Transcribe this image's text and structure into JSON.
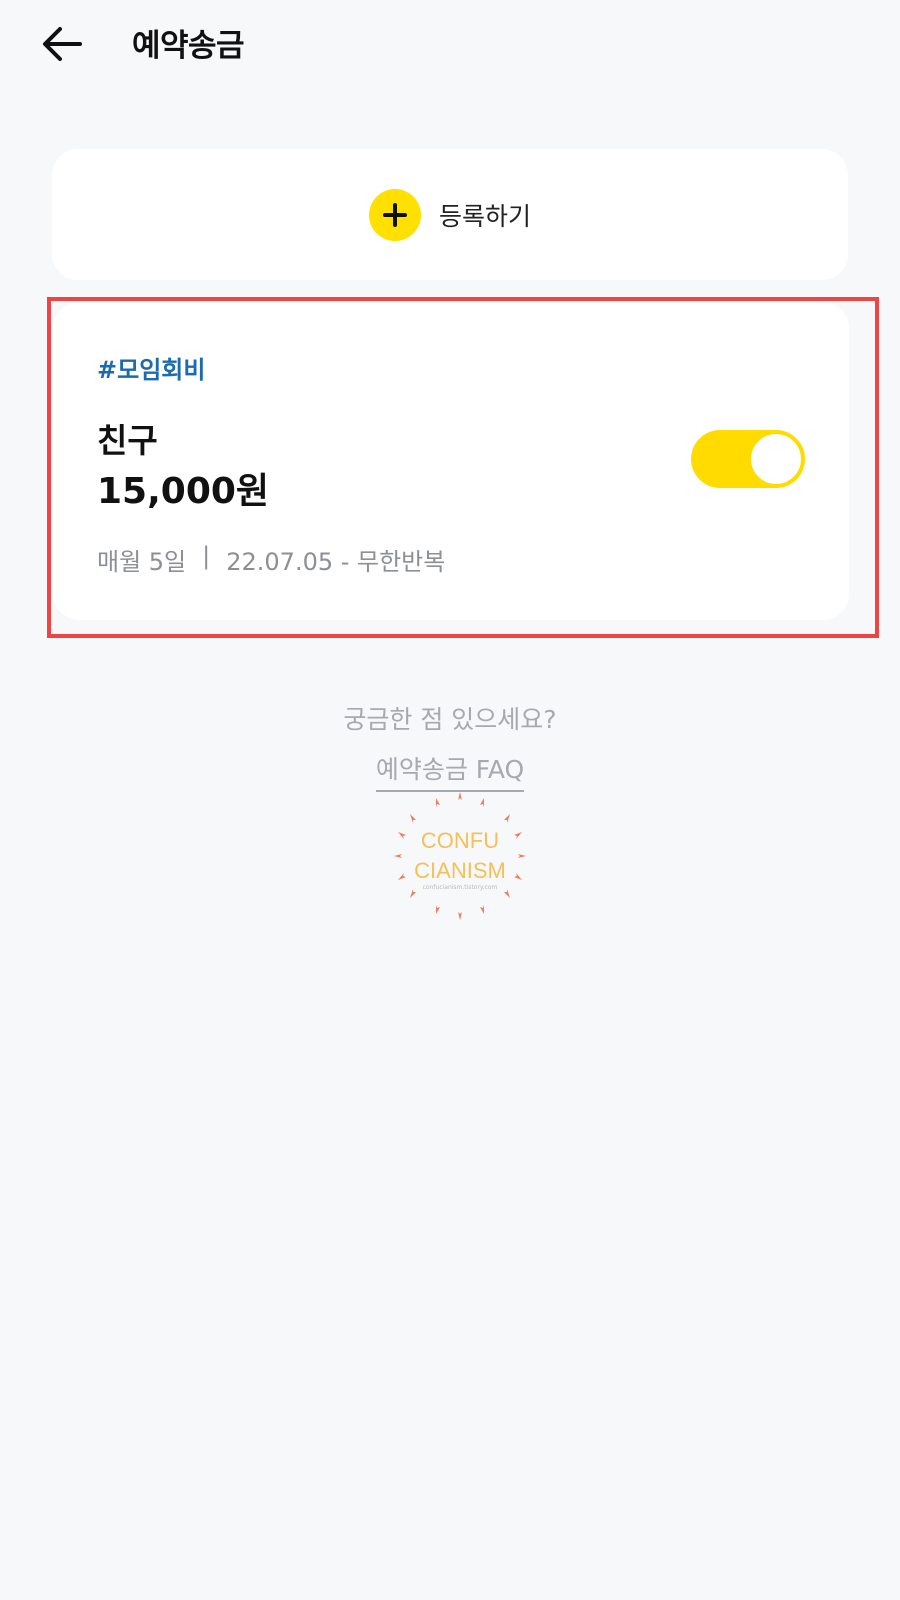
{
  "header": {
    "title": "예약송금",
    "back_icon": "arrow-left-icon"
  },
  "register": {
    "label": "등록하기",
    "icon": "plus-icon",
    "icon_color": "#ffe000"
  },
  "transfer": {
    "tag": "#모임회비",
    "recipient": "친구",
    "amount": "15,000원",
    "schedule_day": "매월 5일",
    "separator": "|",
    "schedule_period": "22.07.05 - 무한반복",
    "toggle_on": true,
    "toggle_color": "#ffdb00",
    "highlight_color": "#f04444"
  },
  "faq": {
    "question": "궁금한 점 있으세요?",
    "link": "예약송금 FAQ"
  },
  "watermark": {
    "line1": "CONFU",
    "line2": "CIANISM",
    "small": "confucianism.tistory.com"
  }
}
